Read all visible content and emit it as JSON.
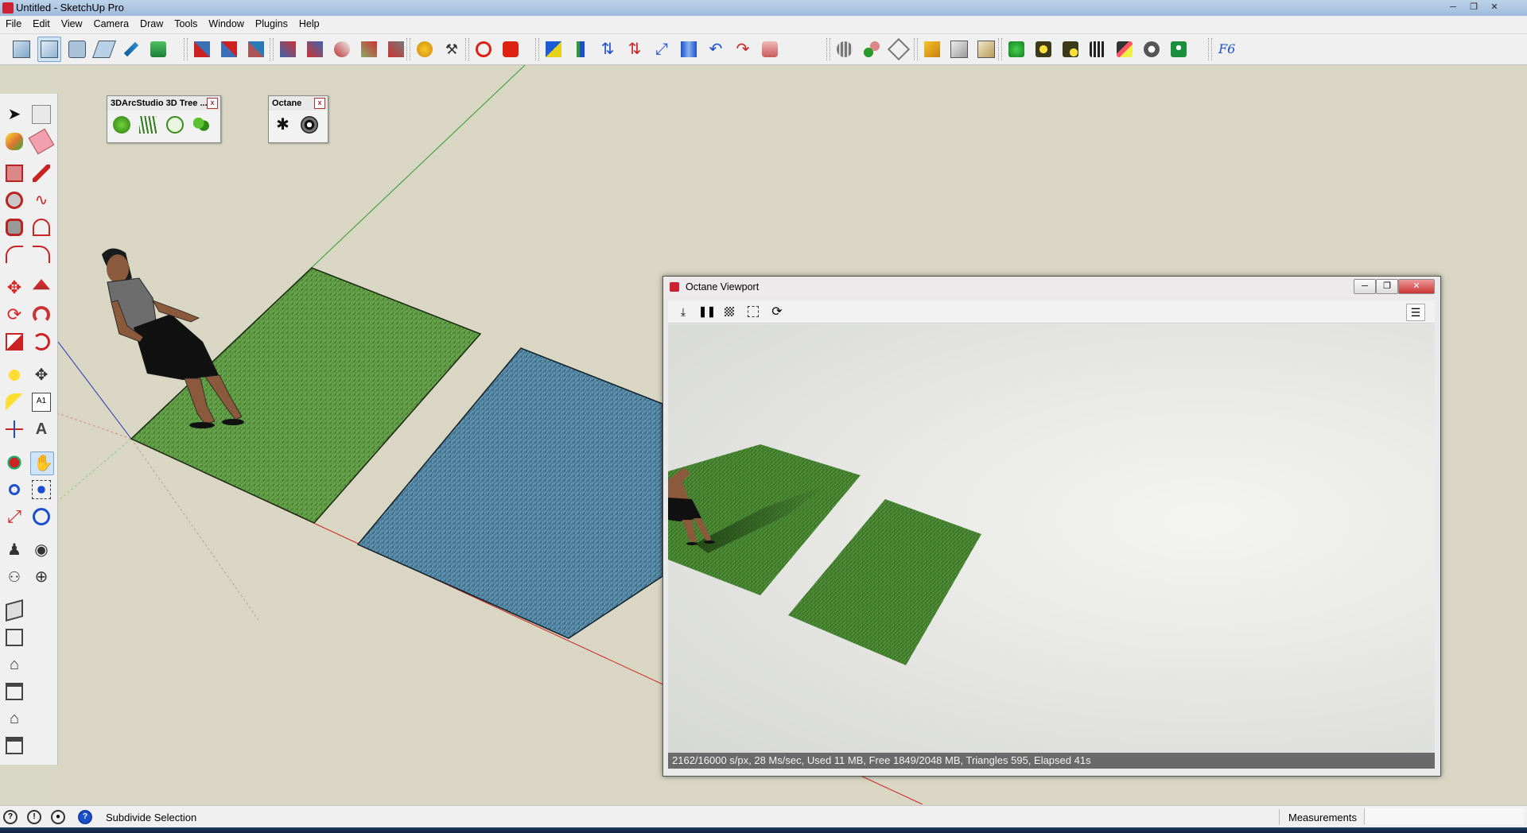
{
  "window": {
    "title": "Untitled - SketchUp Pro",
    "min_icon": "minimize-icon",
    "max_icon": "maximize-icon",
    "close_icon": "close-icon"
  },
  "menu": [
    "File",
    "Edit",
    "View",
    "Camera",
    "Draw",
    "Tools",
    "Window",
    "Plugins",
    "Help"
  ],
  "toolbar": {
    "groups": [
      {
        "icons": [
          "iso-view-icon",
          "top-view-icon",
          "front-view-icon",
          "right-view-icon",
          "back-view-icon",
          "left-view-icon"
        ]
      },
      {
        "icons": [
          "xray-icon",
          "back-edges-icon",
          "wireframe-icon",
          "hidden-line-icon",
          "shaded-icon"
        ]
      },
      {
        "icons": [
          "shaded-texture-icon",
          "monochrome-icon",
          "sandbox-icon",
          "stamp-icon",
          "drape-icon"
        ]
      },
      {
        "icons": [
          "compass-icon",
          "tools-icon"
        ]
      },
      {
        "icons": [
          "ruby-icon",
          "camera-icon"
        ]
      },
      {
        "icons": [
          "cube-color-icon",
          "axis-icon",
          "move-up-icon",
          "move-down-icon",
          "scale-diagonal-icon",
          "flip-icon",
          "undo-icon",
          "redo-icon",
          "paint-icon"
        ]
      },
      {
        "icons": [
          "shell-icon",
          "intersect-icon",
          "trim-icon"
        ]
      },
      {
        "icons": [
          "component-icon",
          "component-edit-icon",
          "component-group-icon"
        ]
      },
      {
        "icons": [
          "power-icon",
          "sun-icon",
          "cursor-light-icon",
          "film-icon",
          "material-icon",
          "settings-gear-icon",
          "render-icon",
          "fredo6-icon"
        ]
      }
    ]
  },
  "left_tools": [
    "select-icon",
    "make-component-icon",
    "paint-bucket-icon",
    "eraser-icon",
    "rectangle-icon",
    "pencil-icon",
    "circle-icon",
    "freehand-icon",
    "polygon-icon",
    "arc-icon",
    "two-point-arc-icon",
    "three-point-arc-icon",
    "move-icon",
    "push-pull-icon",
    "rotate-icon",
    "follow-me-icon",
    "scale-icon",
    "offset-icon",
    "tape-measure-icon",
    "dimension-icon",
    "protractor-icon",
    "text-icon",
    "axes-icon",
    "3d-text-icon",
    "orbit-icon",
    "pan-icon",
    "zoom-icon",
    "zoom-window-icon",
    "zoom-extents-icon",
    "previous-view-icon",
    "position-camera-icon",
    "look-around-icon",
    "walk-icon",
    "section-plane-icon",
    "warehouse-icon",
    "share-model-icon",
    "home-icon",
    "layers-icon",
    "house-icon",
    "extension-icon"
  ],
  "palettes": [
    {
      "title": "3DArcStudio 3D Tree ...",
      "close": "x",
      "icons": [
        "tree-round-icon",
        "grass-icon",
        "bush-icon",
        "tree-cluster-icon"
      ]
    },
    {
      "title": "Octane",
      "close": "x",
      "icons": [
        "octane-logo-icon",
        "octane-render-icon"
      ]
    }
  ],
  "octane": {
    "title": "Octane Viewport",
    "tools": [
      "save-render-icon",
      "pause-icon",
      "checker-icon",
      "region-icon",
      "refresh-icon"
    ],
    "menu_icon": "hamburger-menu-icon",
    "status": "2162/16000 s/px, 28 Ms/sec, Used 11 MB, Free 1849/2048 MB, Triangles 595, Elapsed 41s"
  },
  "statusbar": {
    "icons": [
      "geo-location-icon",
      "credits-icon",
      "user-icon",
      "help-icon"
    ],
    "text": "Subdivide Selection",
    "measurements_label": "Measurements",
    "measurements_value": ""
  },
  "colors": {
    "grass_green": "#4f8a2e",
    "grass_blue": "#4f7f9a",
    "sky": "#d9d7c3",
    "axis_red": "#cc2222",
    "axis_green": "#2e9a2e",
    "axis_blue": "#2233bb"
  }
}
